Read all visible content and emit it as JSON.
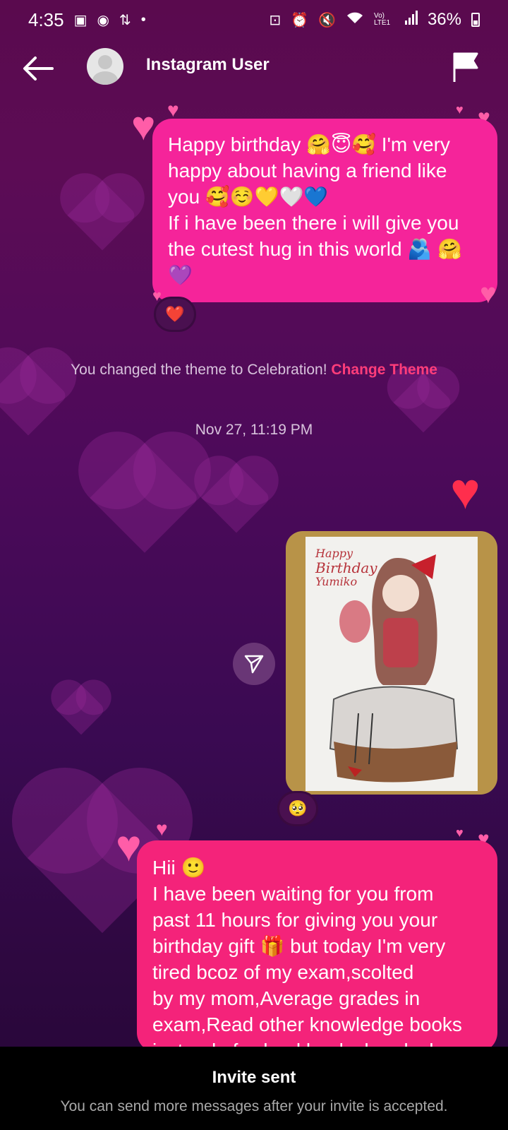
{
  "status_bar": {
    "time": "4:35",
    "battery": "36%",
    "network": "Vo) LTE1"
  },
  "header": {
    "username": "Instagram User"
  },
  "messages": {
    "msg1": {
      "lines": [
        "Happy birthday 🤗😇🥰 I'm very",
        "happy about having a friend like",
        "you 🥰☺️💛🤍💙",
        "If i have been there i will give you",
        "the cutest hug in this world 🫂 🤗",
        "💜"
      ],
      "reaction": "❤️"
    },
    "system_text": "You changed the theme to Celebration!",
    "change_theme_link": "Change Theme",
    "timestamp": "Nov 27, 11:19 PM",
    "image_msg": {
      "caption_lines": [
        "Happy",
        "Birthday",
        "Yumiko"
      ],
      "reaction": "🥺"
    },
    "msg2": {
      "lines": [
        "Hii 🙂",
        "I have been waiting for you from",
        "past 11 hours for giving you your",
        "birthday gift 🎁 but today I'm very",
        "tired bcoz of my exam,scolted",
        "by my mom,Average grades in",
        "exam,Read other knowledge books",
        "instead of school books headache"
      ]
    }
  },
  "footer": {
    "title": "Invite sent",
    "subtitle": "You can send more messages after your invite is accepted."
  },
  "colors": {
    "bubble": "#f5249a",
    "accent_link": "#ff3d7a"
  },
  "icons": {
    "back": "arrow-left-icon",
    "flag": "flag-icon",
    "share": "send-icon"
  }
}
